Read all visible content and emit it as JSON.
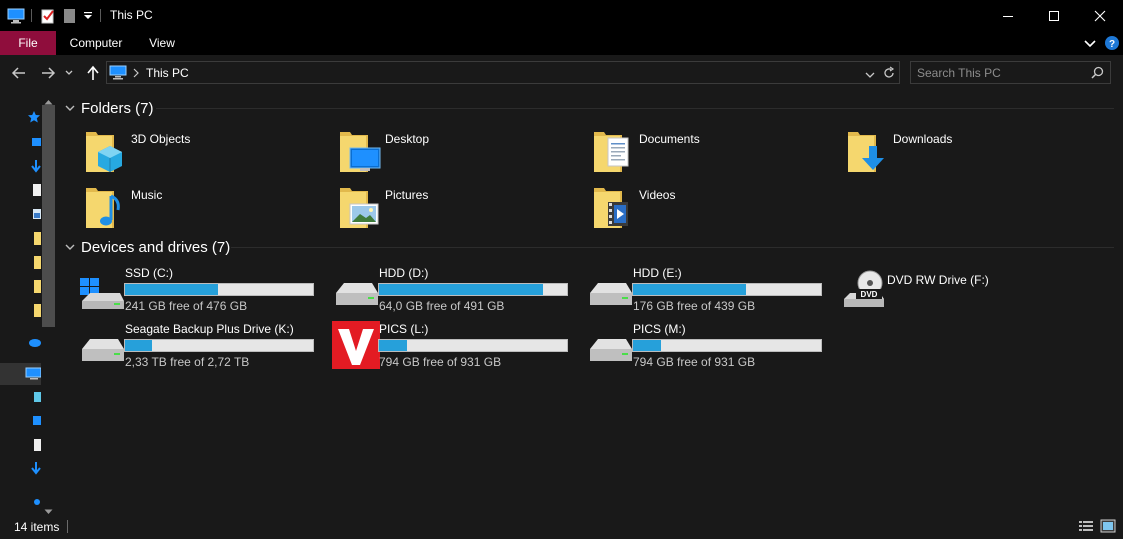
{
  "window": {
    "title": "This PC"
  },
  "ribbon": {
    "tabs": [
      {
        "label": "File"
      },
      {
        "label": "Computer"
      },
      {
        "label": "View"
      }
    ]
  },
  "address": {
    "path": "This PC"
  },
  "search": {
    "placeholder": "Search This PC"
  },
  "groups": {
    "folders": {
      "label": "Folders (7)"
    },
    "drives": {
      "label": "Devices and drives (7)"
    }
  },
  "folders": [
    {
      "name": "3D Objects",
      "icon": "3d-objects-icon"
    },
    {
      "name": "Desktop",
      "icon": "desktop-icon"
    },
    {
      "name": "Documents",
      "icon": "documents-icon"
    },
    {
      "name": "Downloads",
      "icon": "downloads-icon"
    },
    {
      "name": "Music",
      "icon": "music-icon"
    },
    {
      "name": "Pictures",
      "icon": "pictures-icon"
    },
    {
      "name": "Videos",
      "icon": "videos-icon"
    }
  ],
  "drives": [
    {
      "name": "SSD (C:)",
      "free": "241 GB free of 476 GB",
      "used_fraction": 0.494,
      "icon": "windows-drive-icon"
    },
    {
      "name": "HDD (D:)",
      "free": "64,0 GB free of 491 GB",
      "used_fraction": 0.87,
      "icon": "hard-drive-icon"
    },
    {
      "name": "HDD (E:)",
      "free": "176 GB free of 439 GB",
      "used_fraction": 0.599,
      "icon": "hard-drive-icon"
    },
    {
      "name": "DVD RW Drive (F:)",
      "icon": "dvd-drive-icon"
    },
    {
      "name": "Seagate Backup Plus Drive (K:)",
      "free": "2,33 TB free of 2,72 TB",
      "used_fraction": 0.143,
      "icon": "hard-drive-icon"
    },
    {
      "name": "PICS (L:)",
      "free": "794 GB free of 931 GB",
      "used_fraction": 0.147,
      "icon": "vivaldi-logo-icon"
    },
    {
      "name": "PICS (M:)",
      "free": "794 GB free of 931 GB",
      "used_fraction": 0.147,
      "icon": "hard-drive-icon"
    }
  ],
  "status": {
    "item_count": "14 items"
  },
  "colors": {
    "accent": "#8f0d3c",
    "bar_fill": "#26a0da",
    "folder_yellow": "#f5d76e"
  }
}
